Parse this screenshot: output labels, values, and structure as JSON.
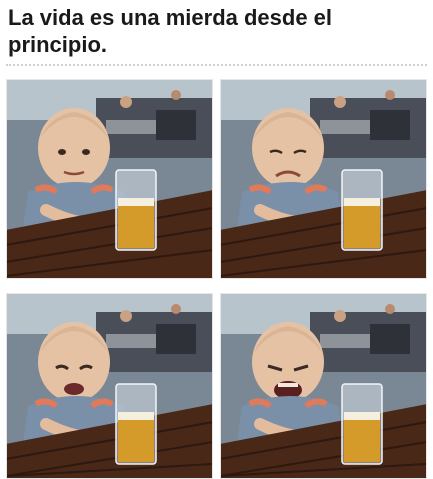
{
  "meme": {
    "caption": "La vida es una mierda desde el principio.",
    "panels": [
      {
        "expression": "neutral"
      },
      {
        "expression": "sad"
      },
      {
        "expression": "sadder"
      },
      {
        "expression": "crying"
      }
    ]
  }
}
